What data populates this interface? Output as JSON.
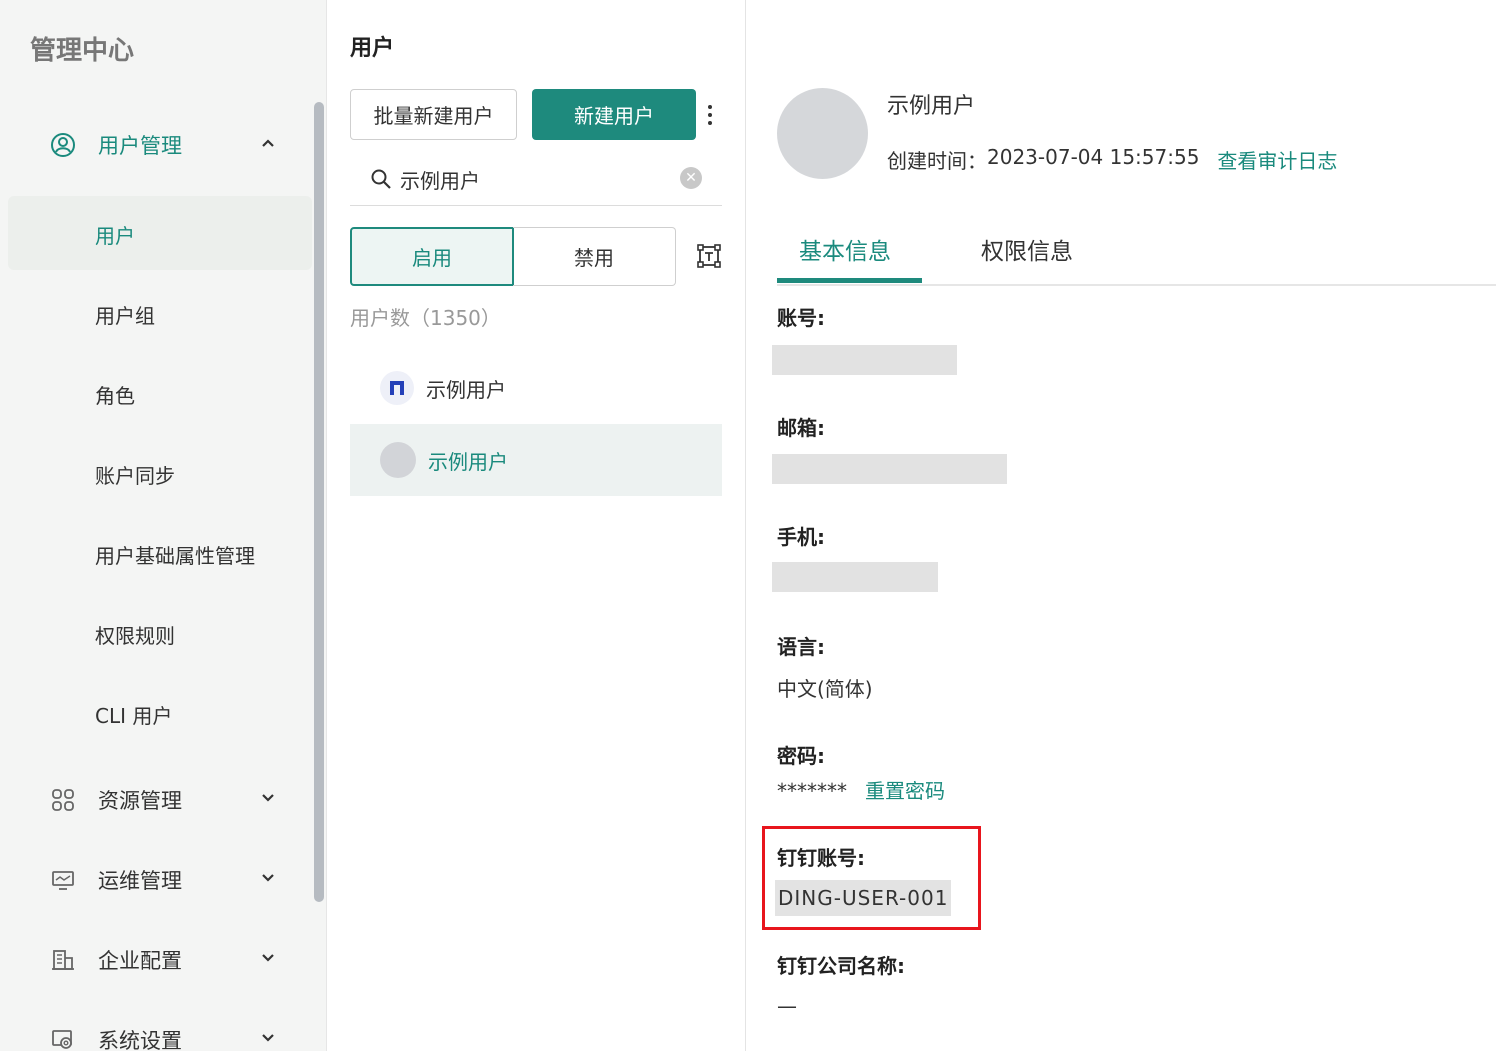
{
  "app": {
    "title": "管理中心"
  },
  "sidebar": {
    "groups": [
      {
        "label": "用户管理",
        "icon": "user-circle-icon",
        "expanded": true
      },
      {
        "label": "资源管理",
        "icon": "grid-icon"
      },
      {
        "label": "运维管理",
        "icon": "monitor-icon"
      },
      {
        "label": "企业配置",
        "icon": "building-icon"
      },
      {
        "label": "系统设置",
        "icon": "settings-icon"
      }
    ],
    "user_items": [
      "用户",
      "用户组",
      "角色",
      "账户同步",
      "用户基础属性管理",
      "权限规则",
      "CLI 用户"
    ],
    "active_item": "用户"
  },
  "middle": {
    "title": "用户",
    "batch_create_label": "批量新建用户",
    "create_label": "新建用户",
    "search": {
      "value": "示例用户",
      "placeholder": ""
    },
    "segments": {
      "enabled": "启用",
      "disabled": "禁用",
      "active": "启用"
    },
    "count_text": "用户数（1350）",
    "users": [
      {
        "name": "示例用户",
        "avatar": "dingtalk-logo-icon",
        "selected": false
      },
      {
        "name": "示例用户",
        "avatar": "gray-avatar",
        "selected": true
      }
    ]
  },
  "detail": {
    "name": "示例用户",
    "created_label": "创建时间：",
    "created_value": "2023-07-04 15:57:55",
    "audit_link": "查看审计日志",
    "tabs": [
      "基本信息",
      "权限信息"
    ],
    "active_tab": "基本信息",
    "fields": {
      "account_label": "账号:",
      "email_label": "邮箱:",
      "phone_label": "手机:",
      "language_label": "语言:",
      "language_value": "中文(简体)",
      "password_label": "密码:",
      "password_value": "*******",
      "reset_password": "重置密码",
      "dingtalk_account_label": "钉钉账号:",
      "dingtalk_account_value": "DING-USER-001",
      "dingtalk_company_label": "钉钉公司名称:",
      "dingtalk_company_value": "—"
    }
  },
  "colors": {
    "accent": "#1e8a7d",
    "highlight_border": "#e8151d"
  }
}
